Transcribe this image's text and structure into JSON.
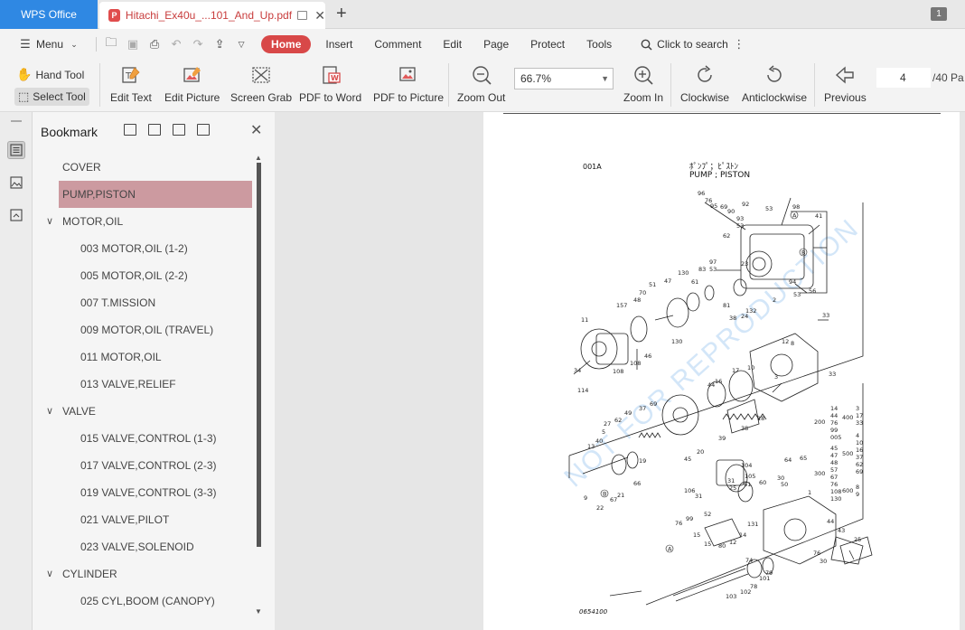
{
  "titlebar": {
    "app_name": "WPS Office",
    "doc_tab_title": "Hitachi_Ex40u_...101_And_Up.pdf",
    "pdf_badge": "P",
    "new_tab": "+",
    "window_count": "1"
  },
  "menubar": {
    "menu_label": "Menu",
    "tabs": [
      "Home",
      "Insert",
      "Comment",
      "Edit",
      "Page",
      "Protect",
      "Tools"
    ],
    "search_label": "Click to search"
  },
  "toolbar": {
    "hand_tool": "Hand Tool",
    "select_tool": "Select Tool",
    "edit_text": "Edit Text",
    "edit_picture": "Edit Picture",
    "screen_grab": "Screen Grab",
    "pdf_to_word": "PDF to Word",
    "pdf_to_picture": "PDF to Picture",
    "zoom_out": "Zoom Out",
    "zoom_level": "66.7%",
    "zoom_in": "Zoom In",
    "clockwise": "Clockwise",
    "anticlockwise": "Anticlockwise",
    "previous": "Previous",
    "current_page": "4",
    "total_pages": "/40 Pa"
  },
  "bookmark": {
    "title": "Bookmark",
    "items": [
      {
        "label": "COVER",
        "level": 0,
        "expandable": false,
        "selected": false
      },
      {
        "label": "PUMP,PISTON",
        "level": 0,
        "expandable": false,
        "selected": true
      },
      {
        "label": "MOTOR,OIL",
        "level": 0,
        "expandable": true,
        "selected": false
      },
      {
        "label": "003 MOTOR,OIL (1-2)",
        "level": 1,
        "expandable": false,
        "selected": false
      },
      {
        "label": "005 MOTOR,OIL (2-2)",
        "level": 1,
        "expandable": false,
        "selected": false
      },
      {
        "label": "007 T.MISSION",
        "level": 1,
        "expandable": false,
        "selected": false
      },
      {
        "label": "009 MOTOR,OIL (TRAVEL)",
        "level": 1,
        "expandable": false,
        "selected": false
      },
      {
        "label": "011 MOTOR,OIL",
        "level": 1,
        "expandable": false,
        "selected": false
      },
      {
        "label": "013 VALVE,RELIEF",
        "level": 1,
        "expandable": false,
        "selected": false
      },
      {
        "label": "VALVE",
        "level": 0,
        "expandable": true,
        "selected": false
      },
      {
        "label": "015 VALVE,CONTROL (1-3)",
        "level": 1,
        "expandable": false,
        "selected": false
      },
      {
        "label": "017 VALVE,CONTROL (2-3)",
        "level": 1,
        "expandable": false,
        "selected": false
      },
      {
        "label": "019 VALVE,CONTROL (3-3)",
        "level": 1,
        "expandable": false,
        "selected": false
      },
      {
        "label": "021 VALVE,PILOT",
        "level": 1,
        "expandable": false,
        "selected": false
      },
      {
        "label": "023 VALVE,SOLENOID",
        "level": 1,
        "expandable": false,
        "selected": false
      },
      {
        "label": "CYLINDER",
        "level": 0,
        "expandable": true,
        "selected": false
      },
      {
        "label": "025 CYL,BOOM (CANOPY)",
        "level": 1,
        "expandable": false,
        "selected": false
      }
    ]
  },
  "document_page": {
    "code": "001A",
    "title_jp": "ﾎﾟﾝﾌﾟ；ﾋﾟｽﾄﾝ",
    "title_en": "PUMP ; PISTON",
    "footer_code": "0654100",
    "watermark": "NOT FOR REPRODUCTION",
    "table_left": [
      "14",
      "44",
      "76",
      "99",
      "005"
    ],
    "table_left_prefix": "200",
    "table_right": [
      "3",
      "17",
      "33"
    ],
    "table_right_prefix": "400",
    "table2_left": [
      "45",
      "47",
      "48",
      "57",
      "67",
      "76",
      "108",
      "130"
    ],
    "table2_left_prefix": "300",
    "table2_right": [
      "4",
      "10",
      "16",
      "37",
      "62",
      "69"
    ],
    "table2_right_prefix": "500",
    "table3_right": [
      "8",
      "9"
    ],
    "table3_right_prefix": "600"
  },
  "colors": {
    "app_tab": "#2f88e3",
    "home_tab": "#d84848",
    "selected_bookmark": "#cc9aa0",
    "doc_tab_text": "#c83c3c"
  }
}
